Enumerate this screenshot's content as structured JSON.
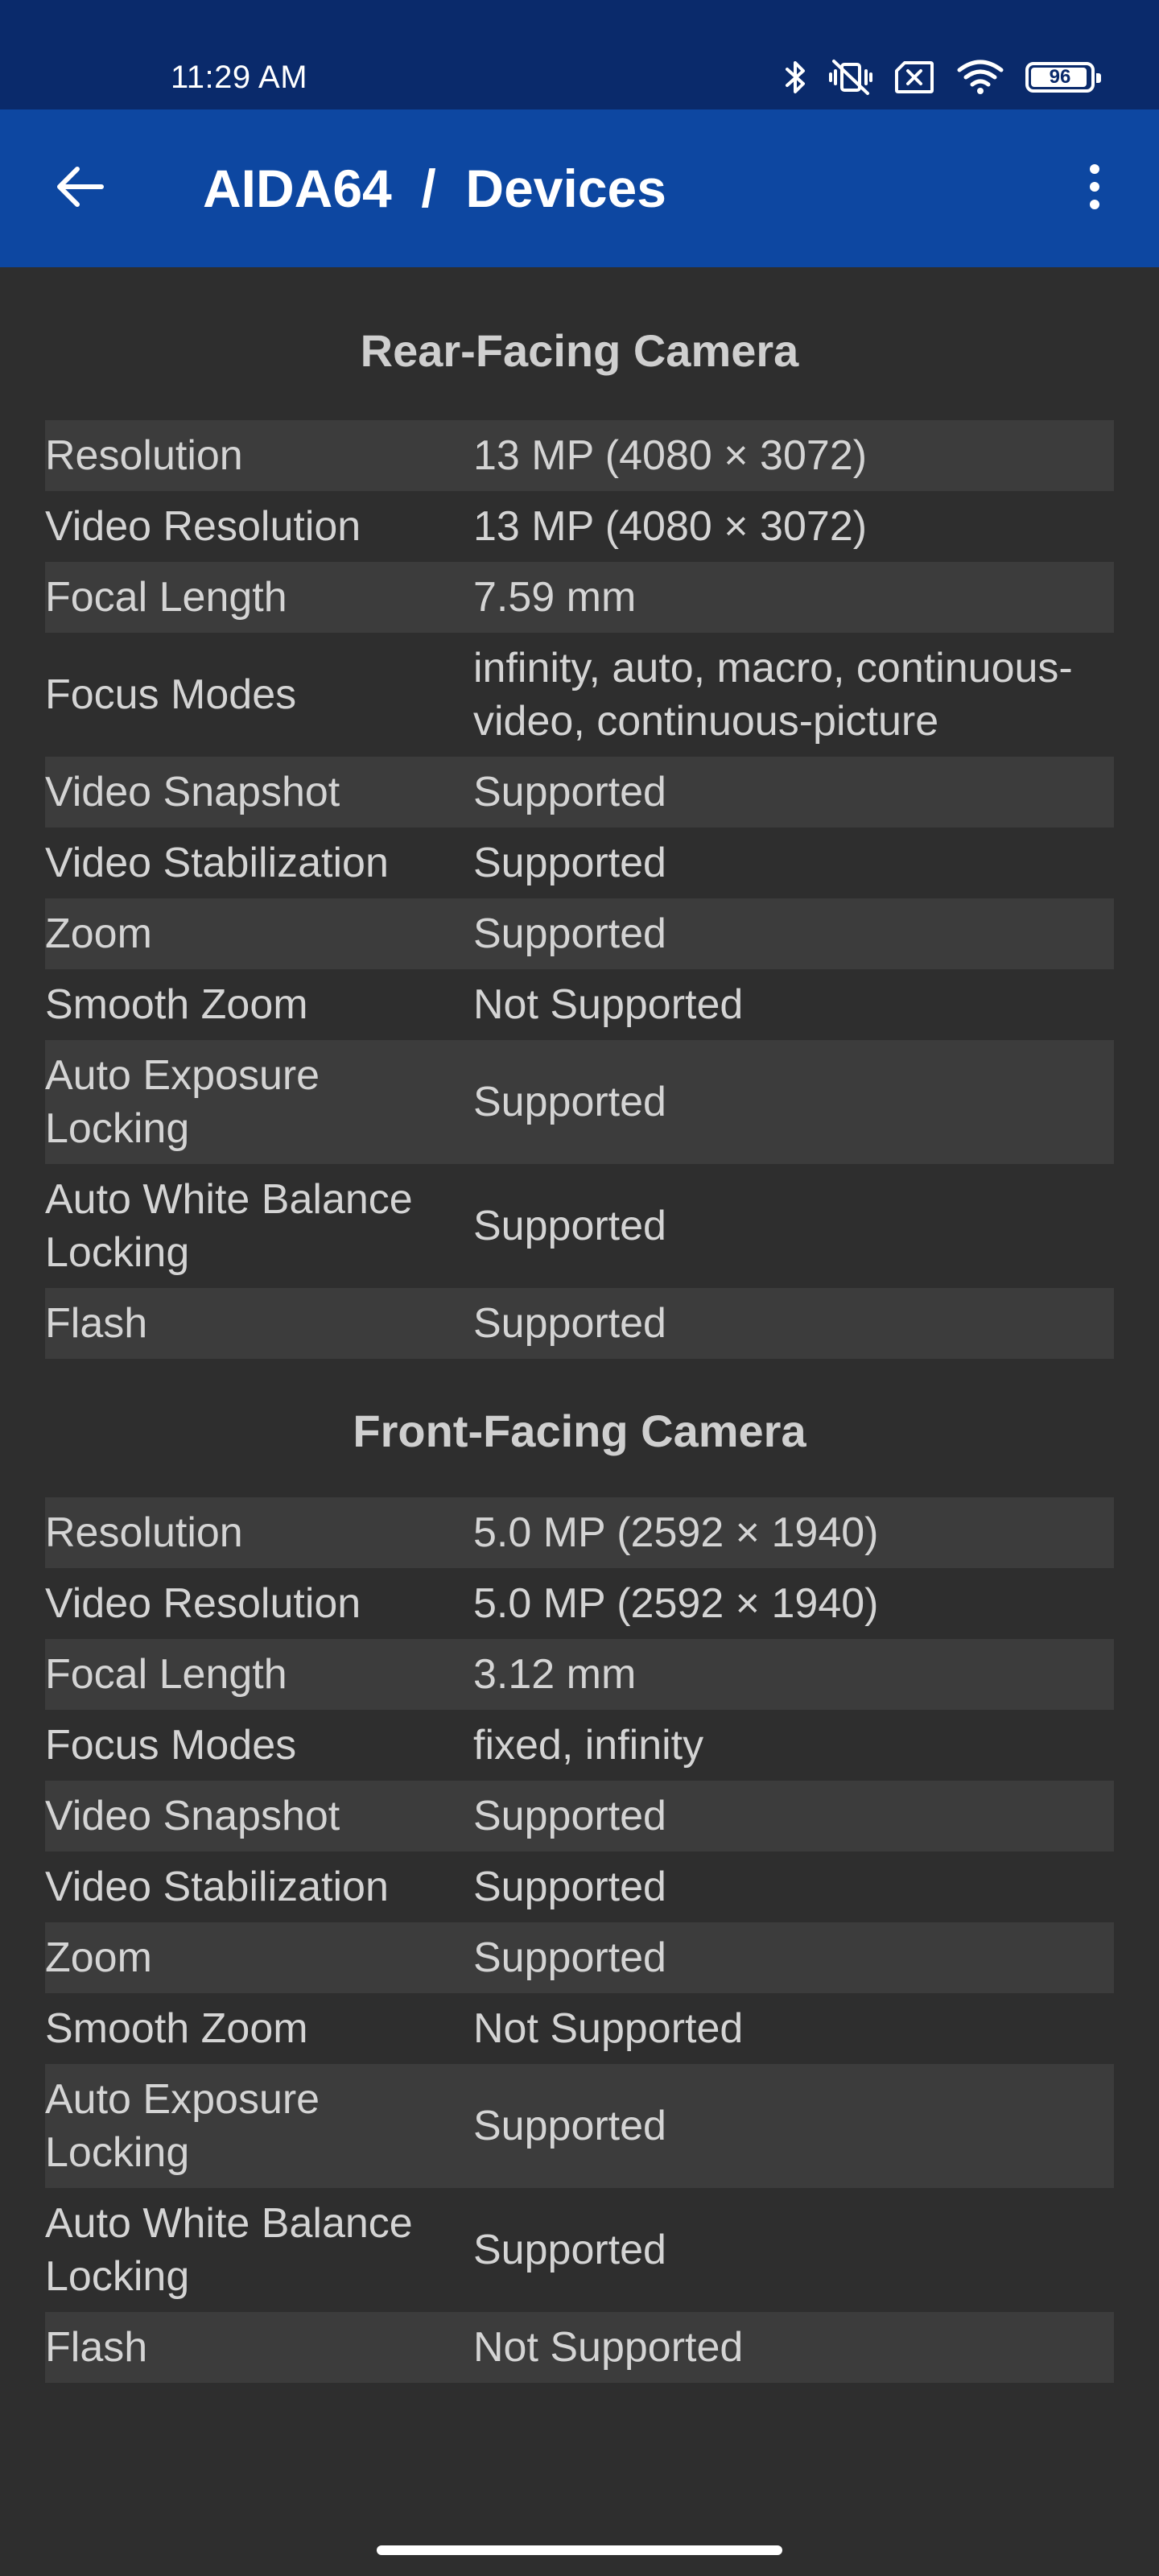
{
  "status_bar": {
    "time": "11:29 AM",
    "battery_level": "96",
    "icons": [
      "bluetooth-icon",
      "vibrate-off-icon",
      "sim-off-icon",
      "wifi-icon",
      "battery-icon"
    ]
  },
  "app_bar": {
    "title": "AIDA64  /  Devices",
    "back_icon": "arrow-left-icon",
    "menu_icon": "more-vertical-icon"
  },
  "colors": {
    "status_bar_bg": "#0a2a6b",
    "app_bar_bg": "#0d47a1",
    "page_bg": "#2e2e2e",
    "row_alt_bg": "#3c3c3c",
    "text": "#d4d4d4"
  },
  "rear_camera": {
    "title": "Rear-Facing Camera",
    "rows": [
      {
        "label": "Resolution",
        "value": "13 MP (4080 × 3072)"
      },
      {
        "label": "Video Resolution",
        "value": "13 MP (4080 × 3072)"
      },
      {
        "label": "Focal Length",
        "value": "7.59 mm"
      },
      {
        "label": "Focus Modes",
        "value": "infinity, auto, macro, continuous-video, continuous-picture"
      },
      {
        "label": "Video Snapshot",
        "value": "Supported"
      },
      {
        "label": "Video Stabilization",
        "value": "Supported"
      },
      {
        "label": "Zoom",
        "value": "Supported"
      },
      {
        "label": "Smooth Zoom",
        "value": "Not Supported"
      },
      {
        "label": "Auto Exposure Locking",
        "value": "Supported"
      },
      {
        "label": "Auto White Balance Locking",
        "value": "Supported"
      },
      {
        "label": "Flash",
        "value": "Supported"
      }
    ]
  },
  "front_camera": {
    "title": "Front-Facing Camera",
    "rows": [
      {
        "label": "Resolution",
        "value": "5.0 MP (2592 × 1940)"
      },
      {
        "label": "Video Resolution",
        "value": "5.0 MP (2592 × 1940)"
      },
      {
        "label": "Focal Length",
        "value": "3.12 mm"
      },
      {
        "label": "Focus Modes",
        "value": "fixed, infinity"
      },
      {
        "label": "Video Snapshot",
        "value": "Supported"
      },
      {
        "label": "Video Stabilization",
        "value": "Supported"
      },
      {
        "label": "Zoom",
        "value": "Supported"
      },
      {
        "label": "Smooth Zoom",
        "value": "Not Supported"
      },
      {
        "label": "Auto Exposure Locking",
        "value": "Supported"
      },
      {
        "label": "Auto White Balance Locking",
        "value": "Supported"
      },
      {
        "label": "Flash",
        "value": "Not Supported"
      }
    ]
  }
}
